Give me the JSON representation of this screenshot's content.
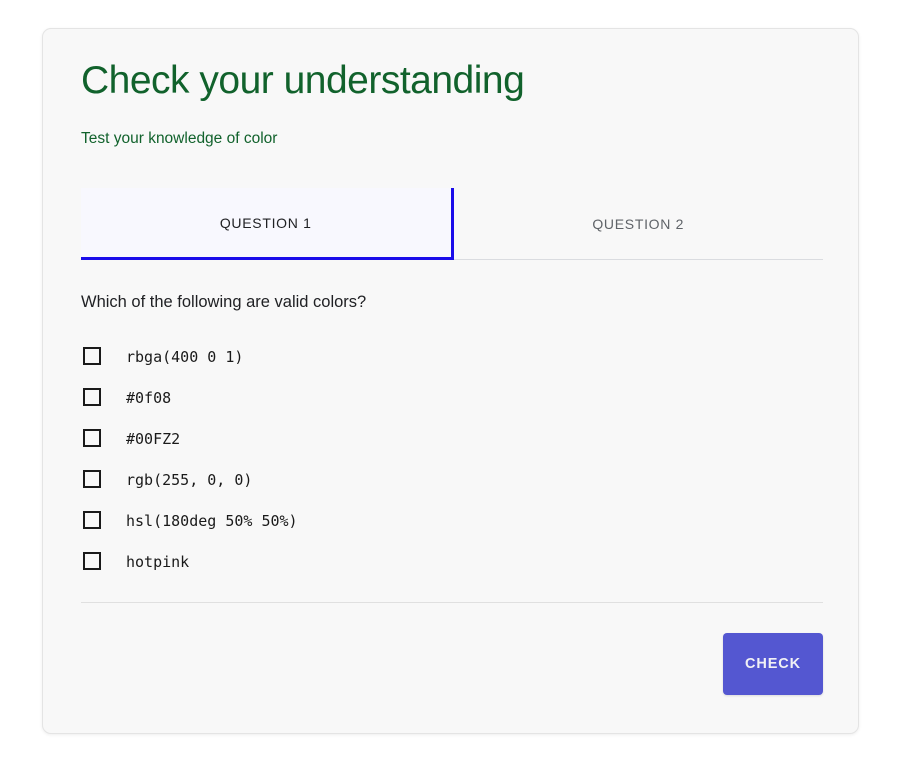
{
  "card": {
    "title": "Check your understanding",
    "subtitle": "Test your knowledge of color",
    "accent_green": "#11622c",
    "accent_blue": "#1a0dea",
    "button_color": "#5457d1",
    "card_background": "#f8f8f8"
  },
  "tabs": [
    {
      "label": "QUESTION 1",
      "active": true
    },
    {
      "label": "QUESTION 2",
      "active": false
    }
  ],
  "question": {
    "prompt": "Which of the following are valid colors?",
    "options": [
      {
        "label": "rbga(400 0 1)",
        "checked": false
      },
      {
        "label": "#0f08",
        "checked": false
      },
      {
        "label": "#00FZ2",
        "checked": false
      },
      {
        "label": "rgb(255, 0, 0)",
        "checked": false
      },
      {
        "label": "hsl(180deg 50% 50%)",
        "checked": false
      },
      {
        "label": "hotpink",
        "checked": false
      }
    ]
  },
  "footer": {
    "check_label": "CHECK"
  }
}
